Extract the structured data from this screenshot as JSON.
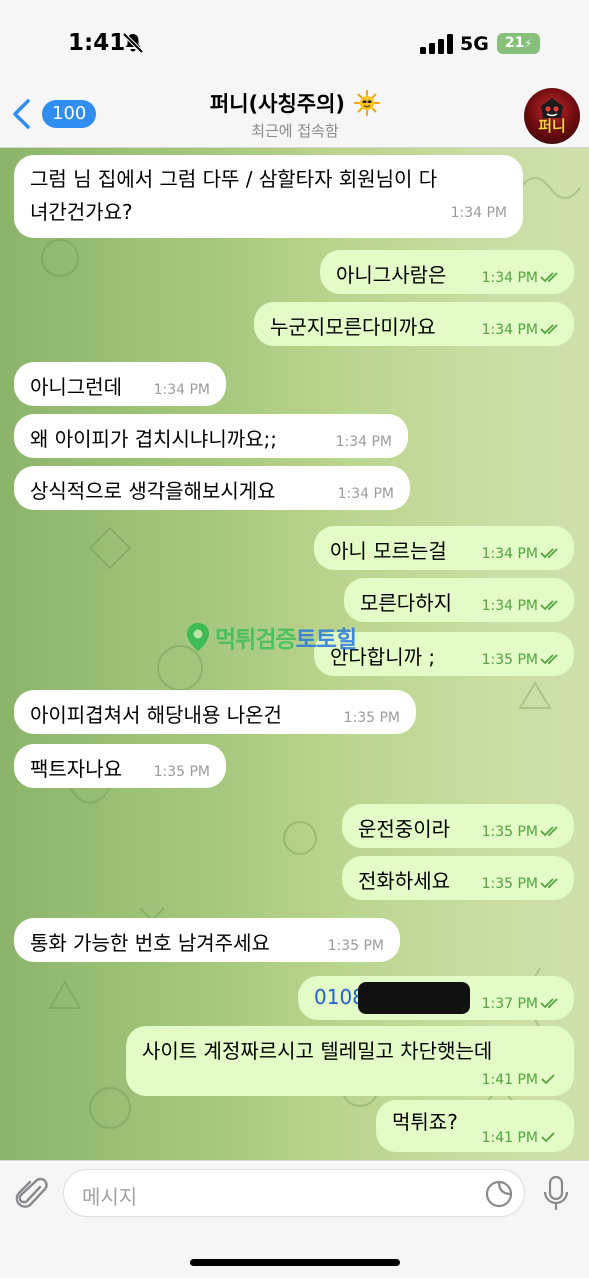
{
  "status_bar": {
    "time": "1:41",
    "network": "5G",
    "battery": "21"
  },
  "header": {
    "back_badge": "100",
    "title": "퍼니(사칭주의)",
    "subtitle": "최근에 접속함",
    "avatar_text": "퍼니"
  },
  "messages": [
    {
      "dir": "in",
      "line1": "그럼 님 집에서 그럼 다뚜 / 삼할타자 회원님이 다",
      "line2": "녀간건가요?",
      "time": "1:34 PM"
    },
    {
      "dir": "out",
      "text": "아니그사람은",
      "time": "1:34 PM",
      "status": "read"
    },
    {
      "dir": "out",
      "text": "누군지모른다미까요",
      "time": "1:34 PM",
      "status": "read"
    },
    {
      "dir": "in",
      "text": "아니그런데",
      "time": "1:34 PM"
    },
    {
      "dir": "in",
      "text": "왜 아이피가 겹치시냐니까요;;",
      "time": "1:34 PM"
    },
    {
      "dir": "in",
      "text": "상식적으로 생각을해보시게요",
      "time": "1:34 PM"
    },
    {
      "dir": "out",
      "text": "아니 모르는걸",
      "time": "1:34 PM",
      "status": "read"
    },
    {
      "dir": "out",
      "text": "모른다하지",
      "time": "1:34 PM",
      "status": "read"
    },
    {
      "dir": "out",
      "text": "안다합니까 ;",
      "time": "1:35 PM",
      "status": "read"
    },
    {
      "dir": "in",
      "text": "아이피겹쳐서 해당내용 나온건",
      "time": "1:35 PM"
    },
    {
      "dir": "in",
      "text": "팩트자나요",
      "time": "1:35 PM"
    },
    {
      "dir": "out",
      "text": "운전중이라",
      "time": "1:35 PM",
      "status": "read"
    },
    {
      "dir": "out",
      "text": "전화하세요",
      "time": "1:35 PM",
      "status": "read"
    },
    {
      "dir": "in",
      "text": "통화 가능한 번호 남겨주세요",
      "time": "1:35 PM"
    },
    {
      "dir": "out",
      "text": "0108",
      "time": "1:37 PM",
      "status": "read"
    },
    {
      "dir": "out",
      "text": "사이트 계정짜르시고 텔레밀고 차단햇는데",
      "time": "1:41 PM",
      "status": "sent"
    },
    {
      "dir": "out",
      "text": "먹튀죠?",
      "time": "1:41 PM",
      "status": "sent"
    }
  ],
  "watermark": {
    "part1": "먹튀검증",
    "part2": "토토힐"
  },
  "input": {
    "placeholder": "메시지"
  },
  "colors": {
    "accent": "#2f8ef0",
    "out_bubble": "#e2fbc7",
    "in_bubble": "#ffffff",
    "tick": "#53a33e"
  }
}
